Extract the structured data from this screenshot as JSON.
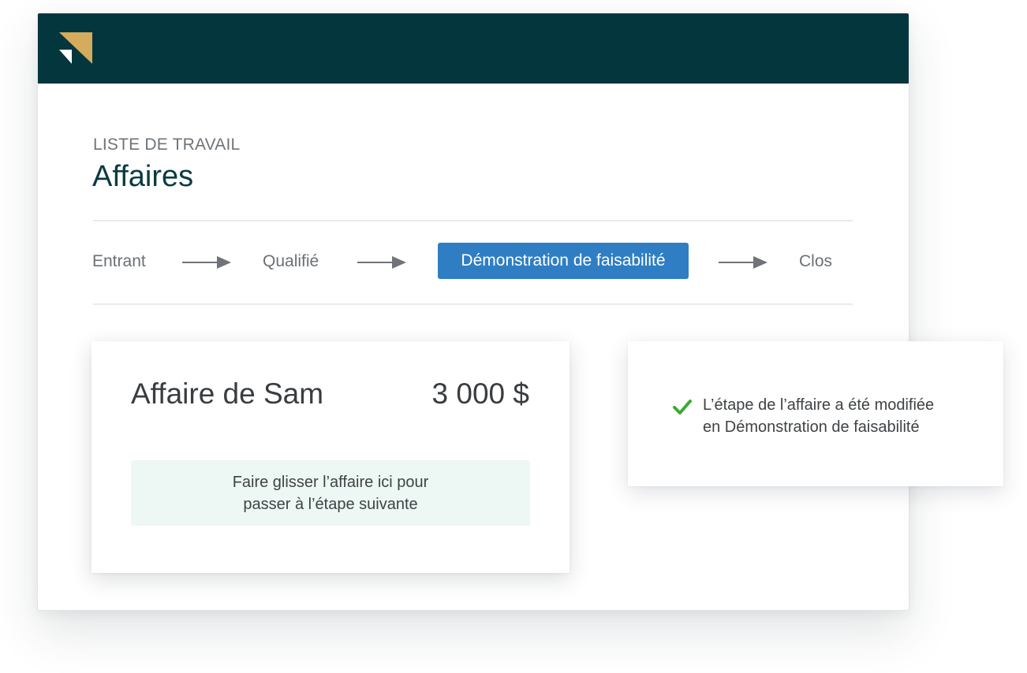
{
  "header": {
    "logo": "brand-logo-icon",
    "background": "#04363e",
    "logo_colors": [
      "#d5ab5c",
      "#ffffff"
    ]
  },
  "page": {
    "eyebrow": "LISTE DE TRAVAIL",
    "title": "Affaires"
  },
  "pipeline": {
    "stages": [
      {
        "label": "Entrant",
        "active": false
      },
      {
        "label": "Qualifié",
        "active": false
      },
      {
        "label": "Démonstration de faisabilité",
        "active": true
      },
      {
        "label": "Clos",
        "active": false
      }
    ],
    "active_color": "#2f7ec3",
    "separator_icon": "arrow-right-icon"
  },
  "deal": {
    "name": "Affaire de Sam",
    "amount": "3 000 $",
    "dropzone_line1": "Faire glisser l’affaire ici pour",
    "dropzone_line2": "passer à l’étape suivante",
    "dropzone_color": "#edf7f3"
  },
  "notification": {
    "icon": "checkmark-icon",
    "icon_color": "#3aaa35",
    "line1": "L’étape de l’affaire a été modifiée",
    "line2": "en Démonstration de faisabilité"
  }
}
